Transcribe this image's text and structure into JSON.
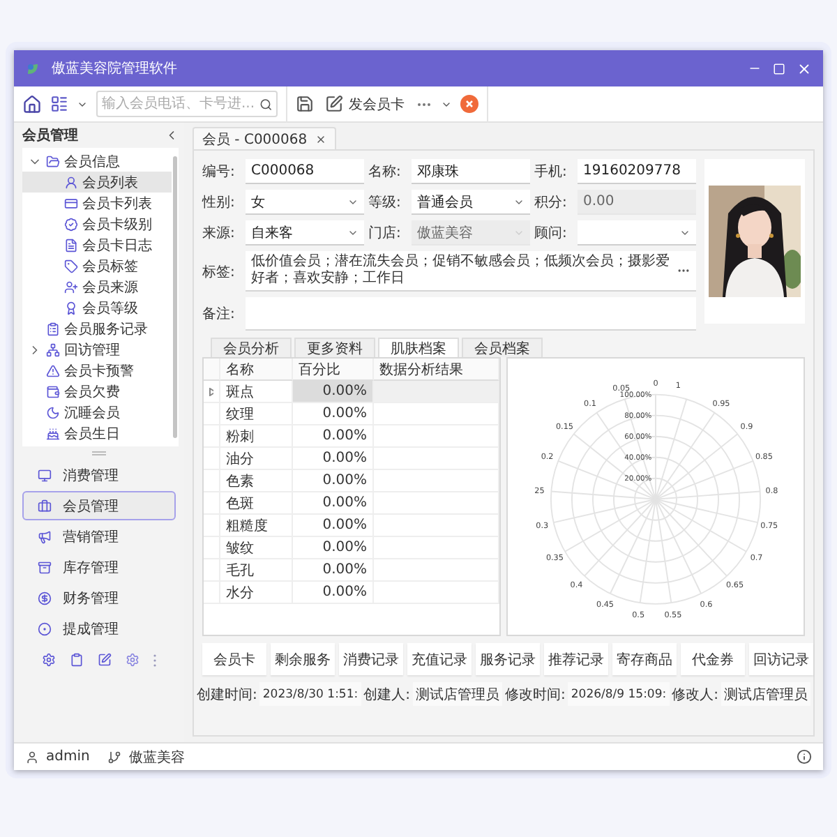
{
  "window": {
    "title": "傲蓝美容院管理软件"
  },
  "toolbar": {
    "search": {
      "placeholder": "输入会员电话、卡号进..."
    },
    "issue_card": "发会员卡"
  },
  "sidebar": {
    "title": "会员管理",
    "tree": [
      {
        "label": "会员信息",
        "expanded": true,
        "selected": false,
        "children": [
          {
            "label": "会员列表",
            "selected": true
          },
          {
            "label": "会员卡列表",
            "selected": false
          },
          {
            "label": "会员卡级别",
            "selected": false
          },
          {
            "label": "会员卡日志",
            "selected": false
          },
          {
            "label": "会员标签",
            "selected": false
          },
          {
            "label": "会员来源",
            "selected": false
          },
          {
            "label": "会员等级",
            "selected": false
          }
        ]
      },
      {
        "label": "会员服务记录",
        "selected": false
      },
      {
        "label": "回访管理",
        "expanded": false,
        "selected": false
      },
      {
        "label": "会员卡预警",
        "selected": false
      },
      {
        "label": "会员欠费",
        "selected": false
      },
      {
        "label": "沉睡会员",
        "selected": false
      },
      {
        "label": "会员生日",
        "selected": false
      }
    ],
    "nav": [
      {
        "label": "消费管理",
        "selected": false
      },
      {
        "label": "会员管理",
        "selected": true
      },
      {
        "label": "营销管理",
        "selected": false
      },
      {
        "label": "库存管理",
        "selected": false
      },
      {
        "label": "财务管理",
        "selected": false
      },
      {
        "label": "提成管理",
        "selected": false
      }
    ]
  },
  "document_tab": {
    "label": "会员 - C000068"
  },
  "form": {
    "fields": [
      {
        "label": "编号:",
        "value": "C000068",
        "kind": "text",
        "disabled": false
      },
      {
        "label": "名称:",
        "value": "邓康珠",
        "kind": "text",
        "disabled": false
      },
      {
        "label": "手机:",
        "value": "19160209778",
        "kind": "text",
        "disabled": false
      },
      {
        "label": "性别:",
        "value": "女",
        "kind": "select",
        "disabled": false
      },
      {
        "label": "等级:",
        "value": "普通会员",
        "kind": "select",
        "disabled": false
      },
      {
        "label": "积分:",
        "value": "0.00",
        "kind": "text",
        "disabled": true
      },
      {
        "label": "来源:",
        "value": "自来客",
        "kind": "select",
        "disabled": false
      },
      {
        "label": "门店:",
        "value": "傲蓝美容",
        "kind": "select",
        "disabled": true
      },
      {
        "label": "顾问:",
        "kind": "select",
        "disabled": false
      }
    ],
    "tags": {
      "label": "标签:",
      "value": "低价值会员；潜在流失会员；促销不敏感会员；低频次会员；摄影爱好者；喜欢安静；工作日"
    },
    "note": {
      "label": "备注:"
    }
  },
  "subtabs": [
    {
      "label": "会员分析",
      "selected": false
    },
    {
      "label": "更多资料",
      "selected": false
    },
    {
      "label": "肌肤档案",
      "selected": true
    },
    {
      "label": "会员档案",
      "selected": false
    }
  ],
  "table": {
    "columns": [
      "名称",
      "百分比",
      "数据分析结果"
    ],
    "rows": [
      {
        "name": "斑点",
        "percent": "0.00%",
        "selected": true
      },
      {
        "name": "纹理",
        "percent": "0.00%",
        "selected": false
      },
      {
        "name": "粉刺",
        "percent": "0.00%",
        "selected": false
      },
      {
        "name": "油分",
        "percent": "0.00%",
        "selected": false
      },
      {
        "name": "色素",
        "percent": "0.00%",
        "selected": false
      },
      {
        "name": "色斑",
        "percent": "0.00%",
        "selected": false
      },
      {
        "name": "粗糙度",
        "percent": "0.00%",
        "selected": false
      },
      {
        "name": "皱纹",
        "percent": "0.00%",
        "selected": false
      },
      {
        "name": "毛孔",
        "percent": "0.00%",
        "selected": false
      },
      {
        "name": "水分",
        "percent": "0.00%",
        "selected": false
      }
    ]
  },
  "polar_chart": {
    "angle_labels": [
      "0",
      "0.05",
      "0.1",
      "0.15",
      "0.2",
      "25",
      "0.3",
      "0.35",
      "0.4",
      "0.45",
      "0.5",
      "0.55",
      "0.6",
      "0.65",
      "0.7",
      "0.75",
      "0.8",
      "0.85",
      "0.9",
      "0.95",
      "1"
    ],
    "radius_labels": [
      "100.00%",
      "80.00%",
      "60.00%",
      "40.00%",
      "20.00%"
    ]
  },
  "action_buttons": [
    "会员卡",
    "剩余服务",
    "消费记录",
    "充值记录",
    "服务记录",
    "推荐记录",
    "寄存商品",
    "代金券",
    "回访记录"
  ],
  "meta": [
    {
      "label": "创建时间:",
      "value": "2023/8/30 1:51:"
    },
    {
      "label": "创建人:",
      "value": "测试店管理员"
    },
    {
      "label": "修改时间:",
      "value": "2026/8/9 15:09:"
    },
    {
      "label": "修改人:",
      "value": "测试店管理员"
    }
  ],
  "status_bar": {
    "user": "admin",
    "store": "傲蓝美容"
  }
}
